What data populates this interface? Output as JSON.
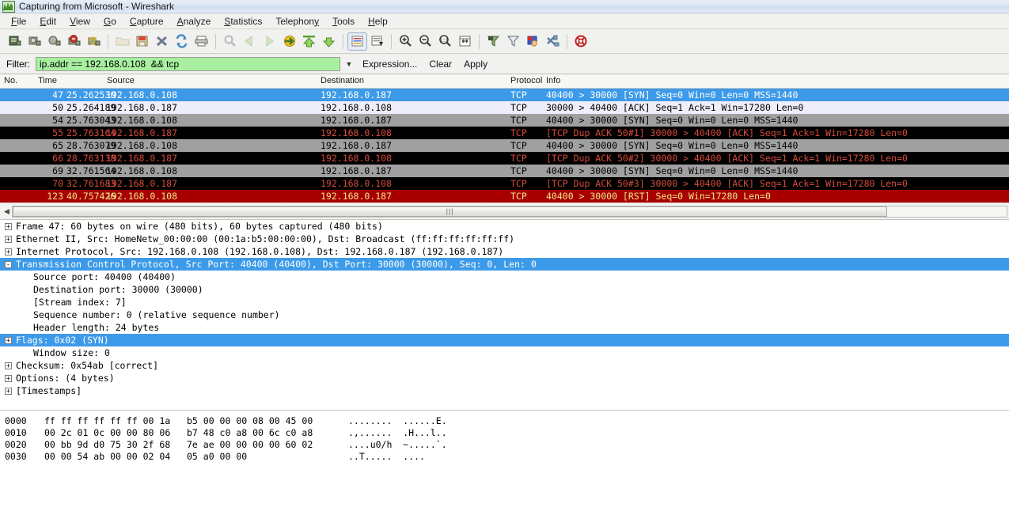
{
  "window": {
    "title": "Capturing from Microsoft  -  Wireshark",
    "logo_icon": "wireshark-waveform-icon"
  },
  "menu": {
    "items": [
      {
        "label": "File",
        "accel": "F"
      },
      {
        "label": "Edit",
        "accel": "E"
      },
      {
        "label": "View",
        "accel": "V"
      },
      {
        "label": "Go",
        "accel": "G"
      },
      {
        "label": "Capture",
        "accel": "C"
      },
      {
        "label": "Analyze",
        "accel": "A"
      },
      {
        "label": "Statistics",
        "accel": "S"
      },
      {
        "label": "Telephony",
        "accel": "T"
      },
      {
        "label": "Tools",
        "accel": "T"
      },
      {
        "label": "Help",
        "accel": "H"
      }
    ]
  },
  "toolbar": {
    "buttons": [
      {
        "name": "interfaces-icon",
        "enabled": true
      },
      {
        "name": "capture-options-icon",
        "enabled": true
      },
      {
        "name": "start-capture-icon",
        "enabled": true
      },
      {
        "name": "stop-capture-icon",
        "enabled": true
      },
      {
        "name": "restart-capture-icon",
        "enabled": true
      },
      {
        "name": "open-file-icon",
        "enabled": false
      },
      {
        "name": "save-file-icon",
        "enabled": true
      },
      {
        "name": "close-file-icon",
        "enabled": true
      },
      {
        "name": "reload-icon",
        "enabled": true
      },
      {
        "name": "print-icon",
        "enabled": true
      },
      {
        "name": "find-packet-icon",
        "enabled": false
      },
      {
        "name": "go-back-icon",
        "enabled": false
      },
      {
        "name": "go-forward-icon",
        "enabled": false
      },
      {
        "name": "go-to-packet-icon",
        "enabled": true
      },
      {
        "name": "go-to-first-icon",
        "enabled": true
      },
      {
        "name": "go-to-last-icon",
        "enabled": true
      },
      {
        "name": "colorize-icon",
        "enabled": true
      },
      {
        "name": "auto-scroll-icon",
        "enabled": true
      },
      {
        "name": "zoom-in-icon",
        "enabled": true
      },
      {
        "name": "zoom-out-icon",
        "enabled": true
      },
      {
        "name": "zoom-reset-icon",
        "enabled": true
      },
      {
        "name": "resize-columns-icon",
        "enabled": true
      },
      {
        "name": "capture-filters-icon",
        "enabled": true
      },
      {
        "name": "display-filters-icon",
        "enabled": true
      },
      {
        "name": "coloring-rules-icon",
        "enabled": true
      },
      {
        "name": "preferences-icon",
        "enabled": true
      },
      {
        "name": "help-contents-icon",
        "enabled": true
      }
    ]
  },
  "filter": {
    "label": "Filter:",
    "value": "ip.addr == 192.168.0.108  && tcp",
    "placeholder": "",
    "dropdown_icon": "chevron-down-icon",
    "expression_label": "Expression...",
    "clear_label": "Clear",
    "apply_label": "Apply"
  },
  "packet_list": {
    "columns": [
      "No.",
      "Time",
      "Source",
      "Destination",
      "Protocol",
      "Info"
    ],
    "rows": [
      {
        "no": "47",
        "time": "25.262530",
        "source": "192.168.0.108",
        "destination": "192.168.0.187",
        "protocol": "TCP",
        "info": "40400 > 30000 [SYN] Seq=0 Win=0 Len=0 MSS=1440",
        "bg": "#3d9ae8",
        "fg": "#ffffff",
        "style": "selected"
      },
      {
        "no": "50",
        "time": "25.264189",
        "source": "192.168.0.187",
        "destination": "192.168.0.108",
        "protocol": "TCP",
        "info": "30000 > 40400 [ACK] Seq=1 Ack=1 Win=17280 Len=0",
        "bg": "#eeeefa",
        "fg": "#000000",
        "style": "tcp-normal"
      },
      {
        "no": "54",
        "time": "25.763043",
        "source": "192.168.0.108",
        "destination": "192.168.0.187",
        "protocol": "TCP",
        "info": "40400 > 30000 [SYN] Seq=0 Win=0 Len=0 MSS=1440",
        "bg": "#a0a0a0",
        "fg": "#000000",
        "style": "tcp-retransmit"
      },
      {
        "no": "55",
        "time": "25.763164",
        "source": "192.168.0.187",
        "destination": "192.168.0.108",
        "protocol": "TCP",
        "info": "[TCP Dup ACK 50#1] 30000 > 40400 [ACK] Seq=1 Ack=1 Win=17280 Len=0",
        "bg": "#000000",
        "fg": "#d44a3c",
        "style": "bad-tcp"
      },
      {
        "no": "65",
        "time": "28.763079",
        "source": "192.168.0.108",
        "destination": "192.168.0.187",
        "protocol": "TCP",
        "info": "40400 > 30000 [SYN] Seq=0 Win=0 Len=0 MSS=1440",
        "bg": "#a0a0a0",
        "fg": "#000000",
        "style": "tcp-retransmit"
      },
      {
        "no": "66",
        "time": "28.763138",
        "source": "192.168.0.187",
        "destination": "192.168.0.108",
        "protocol": "TCP",
        "info": "[TCP Dup ACK 50#2] 30000 > 40400 [ACK] Seq=1 Ack=1 Win=17280 Len=0",
        "bg": "#000000",
        "fg": "#d44a3c",
        "style": "bad-tcp"
      },
      {
        "no": "69",
        "time": "32.761564",
        "source": "192.168.0.108",
        "destination": "192.168.0.187",
        "protocol": "TCP",
        "info": "40400 > 30000 [SYN] Seq=0 Win=0 Len=0 MSS=1440",
        "bg": "#a0a0a0",
        "fg": "#000000",
        "style": "tcp-retransmit"
      },
      {
        "no": "70",
        "time": "32.761683",
        "source": "192.168.0.187",
        "destination": "192.168.0.108",
        "protocol": "TCP",
        "info": "[TCP Dup ACK 50#3] 30000 > 40400 [ACK] Seq=1 Ack=1 Win=17280 Len=0",
        "bg": "#000000",
        "fg": "#d44a3c",
        "style": "bad-tcp"
      },
      {
        "no": "123",
        "time": "40.757426",
        "source": "192.168.0.108",
        "destination": "192.168.0.187",
        "protocol": "TCP",
        "info": "40400 > 30000 [RST] Seq=0 Win=17280 Len=0",
        "bg": "#a80000",
        "fg": "#f0e68c",
        "style": "tcp-reset"
      }
    ]
  },
  "hscroll": {
    "left_arrow_icon": "chevron-left-icon",
    "grip_glyph": "|||"
  },
  "detail_tree": {
    "rows": [
      {
        "indent": 0,
        "expander": "+",
        "text": "Frame 47: 60 bytes on wire (480 bits), 60 bytes captured (480 bits)",
        "selected": false
      },
      {
        "indent": 0,
        "expander": "+",
        "text": "Ethernet II, Src: HomeNetw_00:00:00 (00:1a:b5:00:00:00), Dst: Broadcast (ff:ff:ff:ff:ff:ff)",
        "selected": false
      },
      {
        "indent": 0,
        "expander": "+",
        "text": "Internet Protocol, Src: 192.168.0.108 (192.168.0.108), Dst: 192.168.0.187 (192.168.0.187)",
        "selected": false
      },
      {
        "indent": 0,
        "expander": "-",
        "text": "Transmission Control Protocol, Src Port: 40400 (40400), Dst Port: 30000 (30000), Seq: 0, Len: 0",
        "selected": true
      },
      {
        "indent": 1,
        "expander": "",
        "text": "Source port: 40400 (40400)",
        "selected": false
      },
      {
        "indent": 1,
        "expander": "",
        "text": "Destination port: 30000 (30000)",
        "selected": false
      },
      {
        "indent": 1,
        "expander": "",
        "text": "[Stream index: 7]",
        "selected": false
      },
      {
        "indent": 1,
        "expander": "",
        "text": "Sequence number: 0    (relative sequence number)",
        "selected": false
      },
      {
        "indent": 1,
        "expander": "",
        "text": "Header length: 24 bytes",
        "selected": false
      },
      {
        "indent": 0,
        "expander": "+",
        "text": "Flags: 0x02 (SYN)",
        "selected": true
      },
      {
        "indent": 1,
        "expander": "",
        "text": "Window size: 0",
        "selected": false
      },
      {
        "indent": 0,
        "expander": "+",
        "text": "Checksum: 0x54ab [correct]",
        "selected": false
      },
      {
        "indent": 0,
        "expander": "+",
        "text": "Options: (4 bytes)",
        "selected": false
      },
      {
        "indent": 0,
        "expander": "+",
        "text": "[Timestamps]",
        "selected": false
      }
    ]
  },
  "hex_pane": {
    "rows": [
      {
        "offset": "0000",
        "bytes": "ff ff ff ff ff ff 00 1a   b5 00 00 00 08 00 45 00",
        "ascii": "........  ......E."
      },
      {
        "offset": "0010",
        "bytes": "00 2c 01 0c 00 00 80 06   b7 48 c0 a8 00 6c c0 a8",
        "ascii": ".,......  .H...l.."
      },
      {
        "offset": "0020",
        "bytes": "00 bb 9d d0 75 30 2f 68   7e ae 00 00 00 00 60 02",
        "ascii": "....u0/h  ~.....`."
      },
      {
        "offset": "0030",
        "bytes": "00 00 54 ab 00 00 02 04   05 a0 00 00",
        "ascii": "..T.....  ...."
      }
    ]
  }
}
